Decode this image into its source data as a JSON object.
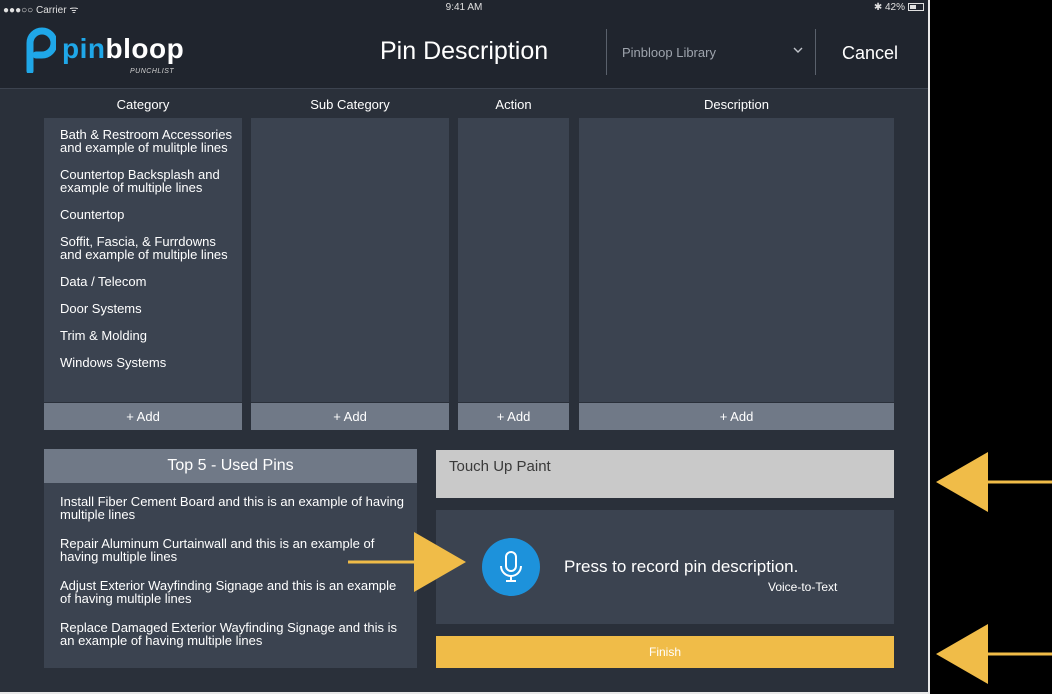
{
  "status_bar": {
    "carrier": "●●●○○ Carrier ᯤ",
    "time": "9:41 AM",
    "battery": "✱ 42%"
  },
  "header": {
    "logo_pin": "pin",
    "logo_bloop": "bloop",
    "logo_sub": "PUNCHLIST",
    "title": "Pin Description",
    "library_select": "Pinbloop Library",
    "cancel_label": "Cancel"
  },
  "columns": {
    "category": {
      "header": "Category",
      "items": [
        "Bath & Restroom Accessories and example of mulitple lines",
        "Countertop Backsplash and example of multiple lines",
        "Countertop",
        "Soffit, Fascia, & Furrdowns and example of multiple lines",
        "Data / Telecom",
        "Door Systems",
        "Trim & Molding",
        "Windows Systems"
      ],
      "add_label": "+ Add"
    },
    "sub_category": {
      "header": "Sub Category",
      "add_label": "+ Add"
    },
    "action": {
      "header": "Action",
      "add_label": "+ Add"
    },
    "description": {
      "header": "Description",
      "add_label": "+ Add"
    }
  },
  "top_pins": {
    "header": "Top 5 - Used Pins",
    "items": [
      "Install Fiber Cement Board and this is an example of having multiple lines",
      "Repair Aluminum Curtainwall and this is an example of having multiple lines",
      "Adjust Exterior Wayfinding Signage and this is an example of having multiple lines",
      "Replace Damaged Exterior Wayfinding Signage and this is an example of having multiple lines"
    ]
  },
  "description_field": {
    "value": "Touch Up Paint"
  },
  "voice": {
    "prompt": "Press to record pin description.",
    "sub_label": "Voice-to-Text",
    "icon": "microphone-icon"
  },
  "finish_label": "Finish",
  "colors": {
    "accent_blue": "#1d92db",
    "finish_yellow": "#f0bc48",
    "panel": "#3b4350",
    "background": "#2a303a",
    "annotation_arrow": "#f0bc48"
  }
}
